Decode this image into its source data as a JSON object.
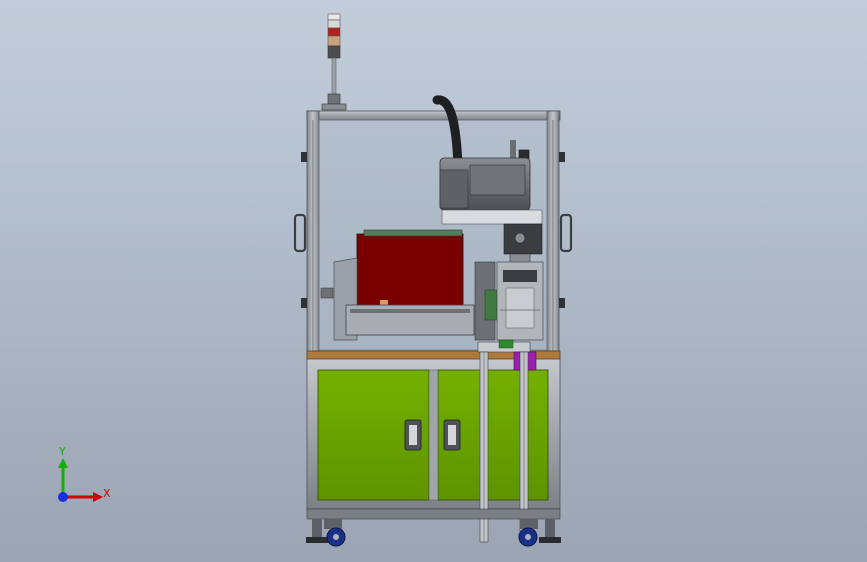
{
  "viewport": {
    "background_top": "#c3cdda",
    "background_bottom": "#9aa4b3"
  },
  "machine": {
    "frame_color": "#9a9fa6",
    "frame_edge": "#5a5e63",
    "cabinet_color": "#6aa300",
    "enclosure_color": "#7a0000",
    "tray_color": "#9b1fb0",
    "caster_color": "#1a2f8a"
  },
  "triad": {
    "y_label": "Y",
    "x_label": "X",
    "y_color": "#13b100",
    "x_color": "#d40000",
    "z_color": "#1a2be0"
  }
}
